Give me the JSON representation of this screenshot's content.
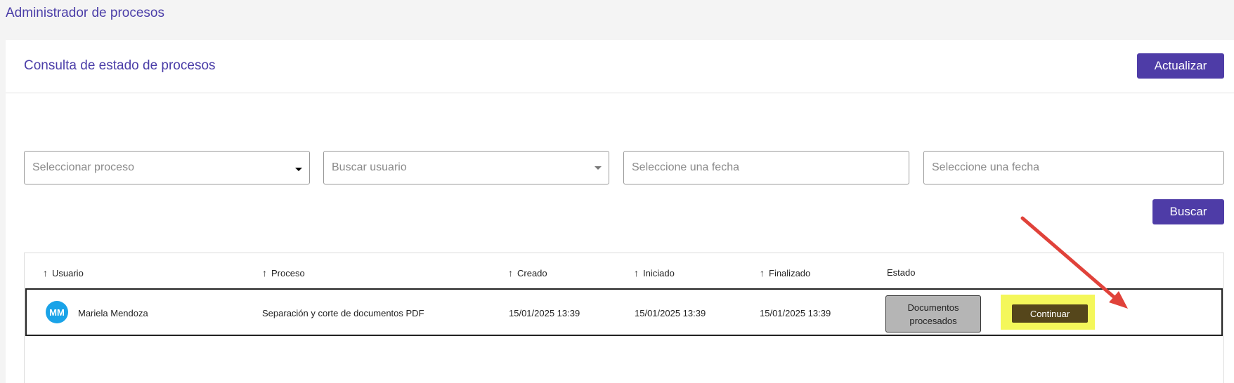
{
  "page": {
    "title": "Administrador de procesos"
  },
  "card": {
    "title": "Consulta de estado de procesos",
    "update_button": "Actualizar",
    "search_button": "Buscar"
  },
  "filters": {
    "process_select": {
      "placeholder": "Seleccionar proceso"
    },
    "user_select": {
      "placeholder": "Buscar usuario"
    },
    "date_from": {
      "placeholder": "Seleccione una fecha"
    },
    "date_to": {
      "placeholder": "Seleccione una fecha"
    }
  },
  "table": {
    "columns": [
      "Usuario",
      "Proceso",
      "Creado",
      "Iniciado",
      "Finalizado",
      "Estado"
    ],
    "rows": [
      {
        "avatar_initials": "MM",
        "user": "Mariela Mendoza",
        "process": "Separación y corte de documentos PDF",
        "created": "15/01/2025 13:39",
        "started": "15/01/2025 13:39",
        "finished": "15/01/2025 13:39",
        "status": "Documentos procesados",
        "action": "Continuar"
      }
    ]
  },
  "colors": {
    "accent": "#4e3ca7",
    "avatar": "#1aa3e8",
    "highlight": "#f4f75a",
    "annotation_arrow": "#e0423a"
  }
}
